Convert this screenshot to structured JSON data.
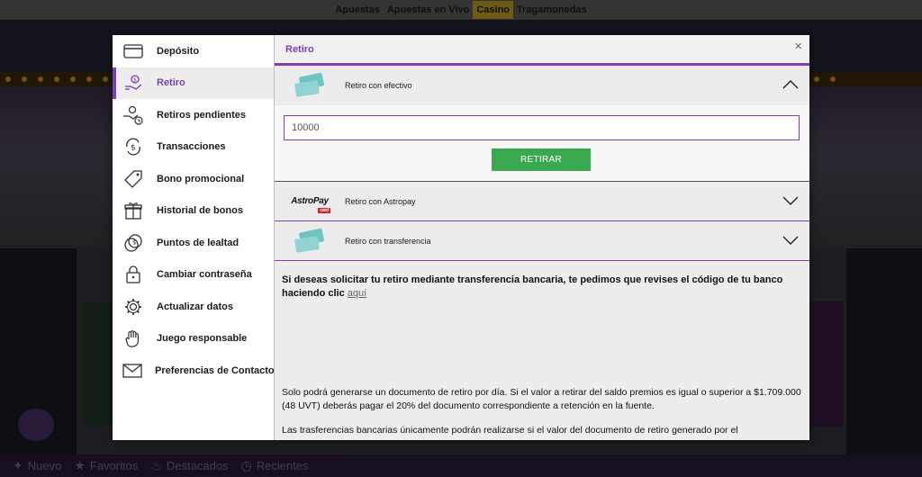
{
  "topnav": {
    "items": [
      {
        "label": "Apuestas",
        "active": false
      },
      {
        "label": "Apuestas en Vivo",
        "active": false
      },
      {
        "label": "Casino",
        "active": true
      },
      {
        "label": "Tragamonedas",
        "active": false
      }
    ]
  },
  "bottombar": {
    "items": [
      {
        "label": "Nuevo",
        "icon": "new-icon"
      },
      {
        "label": "Favoritos",
        "icon": "star-icon"
      },
      {
        "label": "Destacados",
        "icon": "flame-icon"
      },
      {
        "label": "Recientes",
        "icon": "clock-icon"
      }
    ]
  },
  "sidebar": {
    "items": [
      {
        "label": "Depósito",
        "icon": "card-icon",
        "active": false
      },
      {
        "label": "Retiro",
        "icon": "hand-money-icon",
        "active": true
      },
      {
        "label": "Retiros pendientes",
        "icon": "pending-withdraw-icon",
        "active": false
      },
      {
        "label": "Transacciones",
        "icon": "transactions-icon",
        "active": false
      },
      {
        "label": "Bono promocional",
        "icon": "tag-icon",
        "active": false
      },
      {
        "label": "Historial de bonos",
        "icon": "gift-icon",
        "active": false
      },
      {
        "label": "Puntos de lealtad",
        "icon": "coins-icon",
        "active": false
      },
      {
        "label": "Cambiar contraseña",
        "icon": "lock-icon",
        "active": false
      },
      {
        "label": "Actualizar datos",
        "icon": "gear-icon",
        "active": false
      },
      {
        "label": "Juego responsable",
        "icon": "hand-icon",
        "active": false
      },
      {
        "label": "Preferencias de Contacto",
        "icon": "envelope-icon",
        "active": false
      }
    ]
  },
  "content": {
    "title": "Retiro",
    "close_symbol": "×",
    "methods": [
      {
        "label": "Retiro con efectivo",
        "expanded": true
      },
      {
        "label": "Retiro con Astropay",
        "expanded": false,
        "logo_text": "AstroPay",
        "logo_tag": "card"
      },
      {
        "label": "Retiro con transferencia",
        "expanded": false
      }
    ],
    "amount_value": "10000",
    "withdraw_label": "RETIRAR",
    "note_bold": "Si deseas solicitar tu retiro mediante transferencia bancaria, te pedimos que revises el código de tu banco haciendo clic",
    "note_link": "aquí",
    "para1": "Solo podrá generarse un documento de retiro por día. Si el valor a retirar del saldo premios es igual o superior a $1.709.000 (48 UVT) deberás pagar el 20% del documento correspondiente a retención en la fuente.",
    "para2": "Las trasferencias bancarias únicamente podrán realizarse si el valor del documento de retiro generado por el"
  },
  "colors": {
    "accent": "#7b3fb1",
    "button": "#3aa850",
    "card": "#6fc3c4"
  }
}
